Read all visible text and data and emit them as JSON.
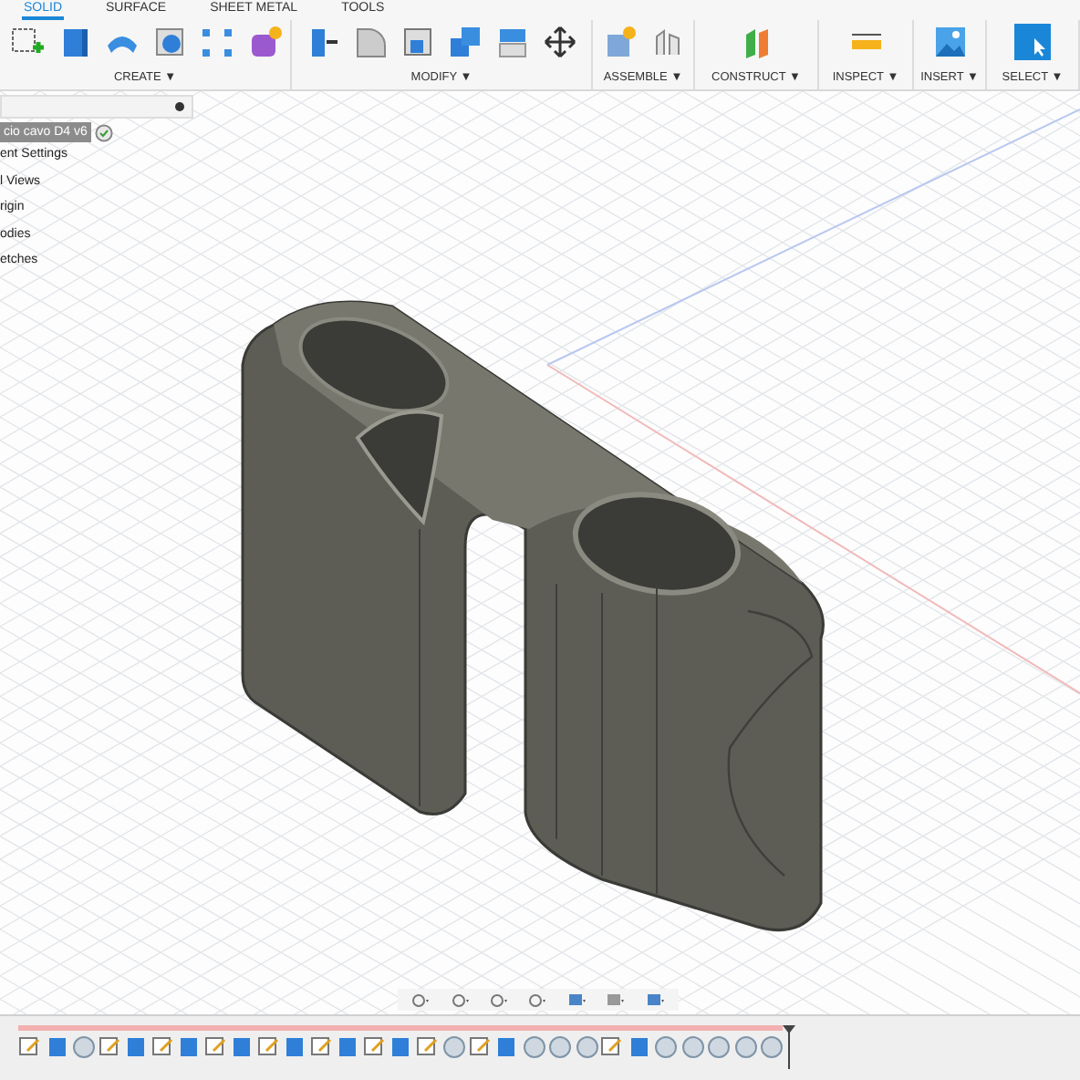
{
  "tabs": [
    {
      "label": "SOLID",
      "selected": true
    },
    {
      "label": "SURFACE",
      "selected": false
    },
    {
      "label": "SHEET METAL",
      "selected": false
    },
    {
      "label": "TOOLS",
      "selected": false
    }
  ],
  "toolbar_groups": [
    {
      "label": "CREATE ▼"
    },
    {
      "label": "MODIFY ▼"
    },
    {
      "label": "ASSEMBLE ▼"
    },
    {
      "label": "CONSTRUCT ▼"
    },
    {
      "label": "INSPECT ▼"
    },
    {
      "label": "INSERT ▼"
    },
    {
      "label": "SELECT ▼"
    }
  ],
  "browser": {
    "root": {
      "label": "cio cavo D4 v6",
      "selected": true,
      "children": [
        {
          "label": "ent Settings"
        },
        {
          "label": "l Views"
        },
        {
          "label": "rigin"
        },
        {
          "label": "odies"
        },
        {
          "label": "etches"
        }
      ]
    }
  },
  "timeline": {
    "features": [
      {
        "kind": "sketch"
      },
      {
        "kind": "body"
      },
      {
        "kind": "fillet"
      },
      {
        "kind": "sketch"
      },
      {
        "kind": "body"
      },
      {
        "kind": "sketch"
      },
      {
        "kind": "body"
      },
      {
        "kind": "sketch"
      },
      {
        "kind": "body"
      },
      {
        "kind": "sketch"
      },
      {
        "kind": "body"
      },
      {
        "kind": "sketch"
      },
      {
        "kind": "body"
      },
      {
        "kind": "sketch"
      },
      {
        "kind": "body"
      },
      {
        "kind": "sketch"
      },
      {
        "kind": "fillet"
      },
      {
        "kind": "sketch"
      },
      {
        "kind": "body"
      },
      {
        "kind": "fillet"
      },
      {
        "kind": "fillet"
      },
      {
        "kind": "fillet"
      },
      {
        "kind": "sketch"
      },
      {
        "kind": "body"
      },
      {
        "kind": "fillet"
      },
      {
        "kind": "fillet"
      },
      {
        "kind": "fillet"
      },
      {
        "kind": "fillet"
      },
      {
        "kind": "fillet"
      }
    ]
  }
}
